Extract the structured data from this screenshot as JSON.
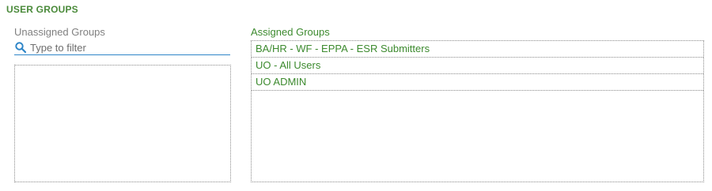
{
  "section": {
    "title": "USER GROUPS"
  },
  "unassigned": {
    "label": "Unassigned Groups",
    "filter_placeholder": "Type to filter",
    "filter_icon": "search-icon",
    "items": []
  },
  "assigned": {
    "label": "Assigned Groups",
    "items": [
      "BA/HR - WF - EPPA - ESR Submitters",
      "UO - All Users",
      "UO ADMIN"
    ]
  },
  "colors": {
    "accent_green": "#3c8a2e",
    "filter_blue": "#2f86c8",
    "muted_gray": "#808080"
  }
}
